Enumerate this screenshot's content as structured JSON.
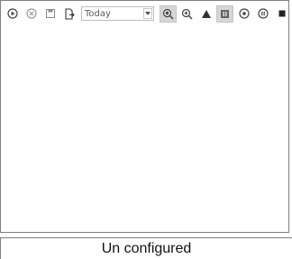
{
  "toolbar": {
    "buttons": [
      {
        "icon": "play-circle-icon"
      },
      {
        "icon": "close-circle-icon"
      },
      {
        "icon": "save-icon"
      },
      {
        "icon": "export-document-icon"
      }
    ],
    "range": {
      "value": "Today"
    },
    "tools": [
      {
        "icon": "zoom-fit-icon",
        "pressed": true
      },
      {
        "icon": "zoom-in-icon",
        "pressed": false
      },
      {
        "icon": "triangle-marker-icon",
        "pressed": false
      },
      {
        "icon": "pause-icon",
        "pressed": true
      },
      {
        "icon": "record-icon",
        "pressed": false
      },
      {
        "icon": "pause-circle-icon",
        "pressed": false
      },
      {
        "icon": "stop-icon",
        "pressed": false
      }
    ]
  },
  "status": {
    "text": "Un configured"
  },
  "colors": {
    "icon": "#444444",
    "border": "#7f7f7f",
    "pressed": "#d6d6d6"
  }
}
